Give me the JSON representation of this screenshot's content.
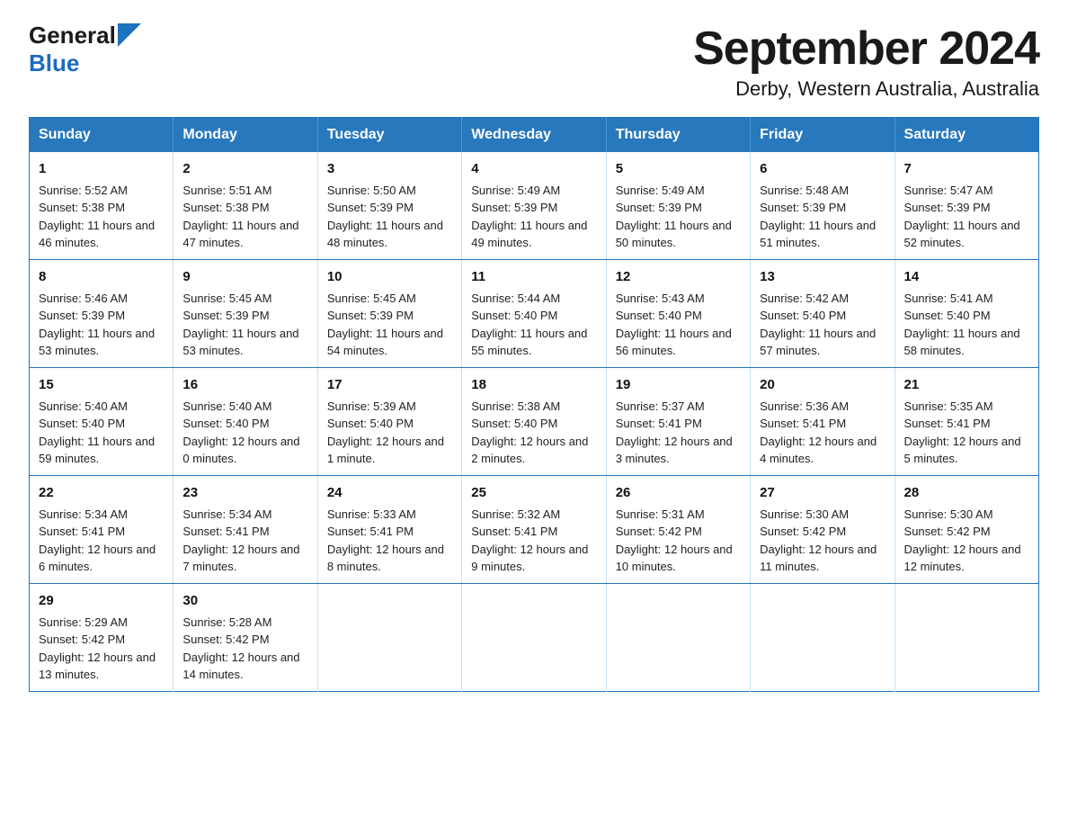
{
  "header": {
    "logo_general": "General",
    "logo_blue": "Blue",
    "title": "September 2024",
    "subtitle": "Derby, Western Australia, Australia"
  },
  "weekdays": [
    "Sunday",
    "Monday",
    "Tuesday",
    "Wednesday",
    "Thursday",
    "Friday",
    "Saturday"
  ],
  "weeks": [
    [
      {
        "day": "1",
        "sunrise": "5:52 AM",
        "sunset": "5:38 PM",
        "daylight": "11 hours and 46 minutes."
      },
      {
        "day": "2",
        "sunrise": "5:51 AM",
        "sunset": "5:38 PM",
        "daylight": "11 hours and 47 minutes."
      },
      {
        "day": "3",
        "sunrise": "5:50 AM",
        "sunset": "5:39 PM",
        "daylight": "11 hours and 48 minutes."
      },
      {
        "day": "4",
        "sunrise": "5:49 AM",
        "sunset": "5:39 PM",
        "daylight": "11 hours and 49 minutes."
      },
      {
        "day": "5",
        "sunrise": "5:49 AM",
        "sunset": "5:39 PM",
        "daylight": "11 hours and 50 minutes."
      },
      {
        "day": "6",
        "sunrise": "5:48 AM",
        "sunset": "5:39 PM",
        "daylight": "11 hours and 51 minutes."
      },
      {
        "day": "7",
        "sunrise": "5:47 AM",
        "sunset": "5:39 PM",
        "daylight": "11 hours and 52 minutes."
      }
    ],
    [
      {
        "day": "8",
        "sunrise": "5:46 AM",
        "sunset": "5:39 PM",
        "daylight": "11 hours and 53 minutes."
      },
      {
        "day": "9",
        "sunrise": "5:45 AM",
        "sunset": "5:39 PM",
        "daylight": "11 hours and 53 minutes."
      },
      {
        "day": "10",
        "sunrise": "5:45 AM",
        "sunset": "5:39 PM",
        "daylight": "11 hours and 54 minutes."
      },
      {
        "day": "11",
        "sunrise": "5:44 AM",
        "sunset": "5:40 PM",
        "daylight": "11 hours and 55 minutes."
      },
      {
        "day": "12",
        "sunrise": "5:43 AM",
        "sunset": "5:40 PM",
        "daylight": "11 hours and 56 minutes."
      },
      {
        "day": "13",
        "sunrise": "5:42 AM",
        "sunset": "5:40 PM",
        "daylight": "11 hours and 57 minutes."
      },
      {
        "day": "14",
        "sunrise": "5:41 AM",
        "sunset": "5:40 PM",
        "daylight": "11 hours and 58 minutes."
      }
    ],
    [
      {
        "day": "15",
        "sunrise": "5:40 AM",
        "sunset": "5:40 PM",
        "daylight": "11 hours and 59 minutes."
      },
      {
        "day": "16",
        "sunrise": "5:40 AM",
        "sunset": "5:40 PM",
        "daylight": "12 hours and 0 minutes."
      },
      {
        "day": "17",
        "sunrise": "5:39 AM",
        "sunset": "5:40 PM",
        "daylight": "12 hours and 1 minute."
      },
      {
        "day": "18",
        "sunrise": "5:38 AM",
        "sunset": "5:40 PM",
        "daylight": "12 hours and 2 minutes."
      },
      {
        "day": "19",
        "sunrise": "5:37 AM",
        "sunset": "5:41 PM",
        "daylight": "12 hours and 3 minutes."
      },
      {
        "day": "20",
        "sunrise": "5:36 AM",
        "sunset": "5:41 PM",
        "daylight": "12 hours and 4 minutes."
      },
      {
        "day": "21",
        "sunrise": "5:35 AM",
        "sunset": "5:41 PM",
        "daylight": "12 hours and 5 minutes."
      }
    ],
    [
      {
        "day": "22",
        "sunrise": "5:34 AM",
        "sunset": "5:41 PM",
        "daylight": "12 hours and 6 minutes."
      },
      {
        "day": "23",
        "sunrise": "5:34 AM",
        "sunset": "5:41 PM",
        "daylight": "12 hours and 7 minutes."
      },
      {
        "day": "24",
        "sunrise": "5:33 AM",
        "sunset": "5:41 PM",
        "daylight": "12 hours and 8 minutes."
      },
      {
        "day": "25",
        "sunrise": "5:32 AM",
        "sunset": "5:41 PM",
        "daylight": "12 hours and 9 minutes."
      },
      {
        "day": "26",
        "sunrise": "5:31 AM",
        "sunset": "5:42 PM",
        "daylight": "12 hours and 10 minutes."
      },
      {
        "day": "27",
        "sunrise": "5:30 AM",
        "sunset": "5:42 PM",
        "daylight": "12 hours and 11 minutes."
      },
      {
        "day": "28",
        "sunrise": "5:30 AM",
        "sunset": "5:42 PM",
        "daylight": "12 hours and 12 minutes."
      }
    ],
    [
      {
        "day": "29",
        "sunrise": "5:29 AM",
        "sunset": "5:42 PM",
        "daylight": "12 hours and 13 minutes."
      },
      {
        "day": "30",
        "sunrise": "5:28 AM",
        "sunset": "5:42 PM",
        "daylight": "12 hours and 14 minutes."
      },
      null,
      null,
      null,
      null,
      null
    ]
  ],
  "labels": {
    "sunrise": "Sunrise:",
    "sunset": "Sunset:",
    "daylight": "Daylight:"
  }
}
